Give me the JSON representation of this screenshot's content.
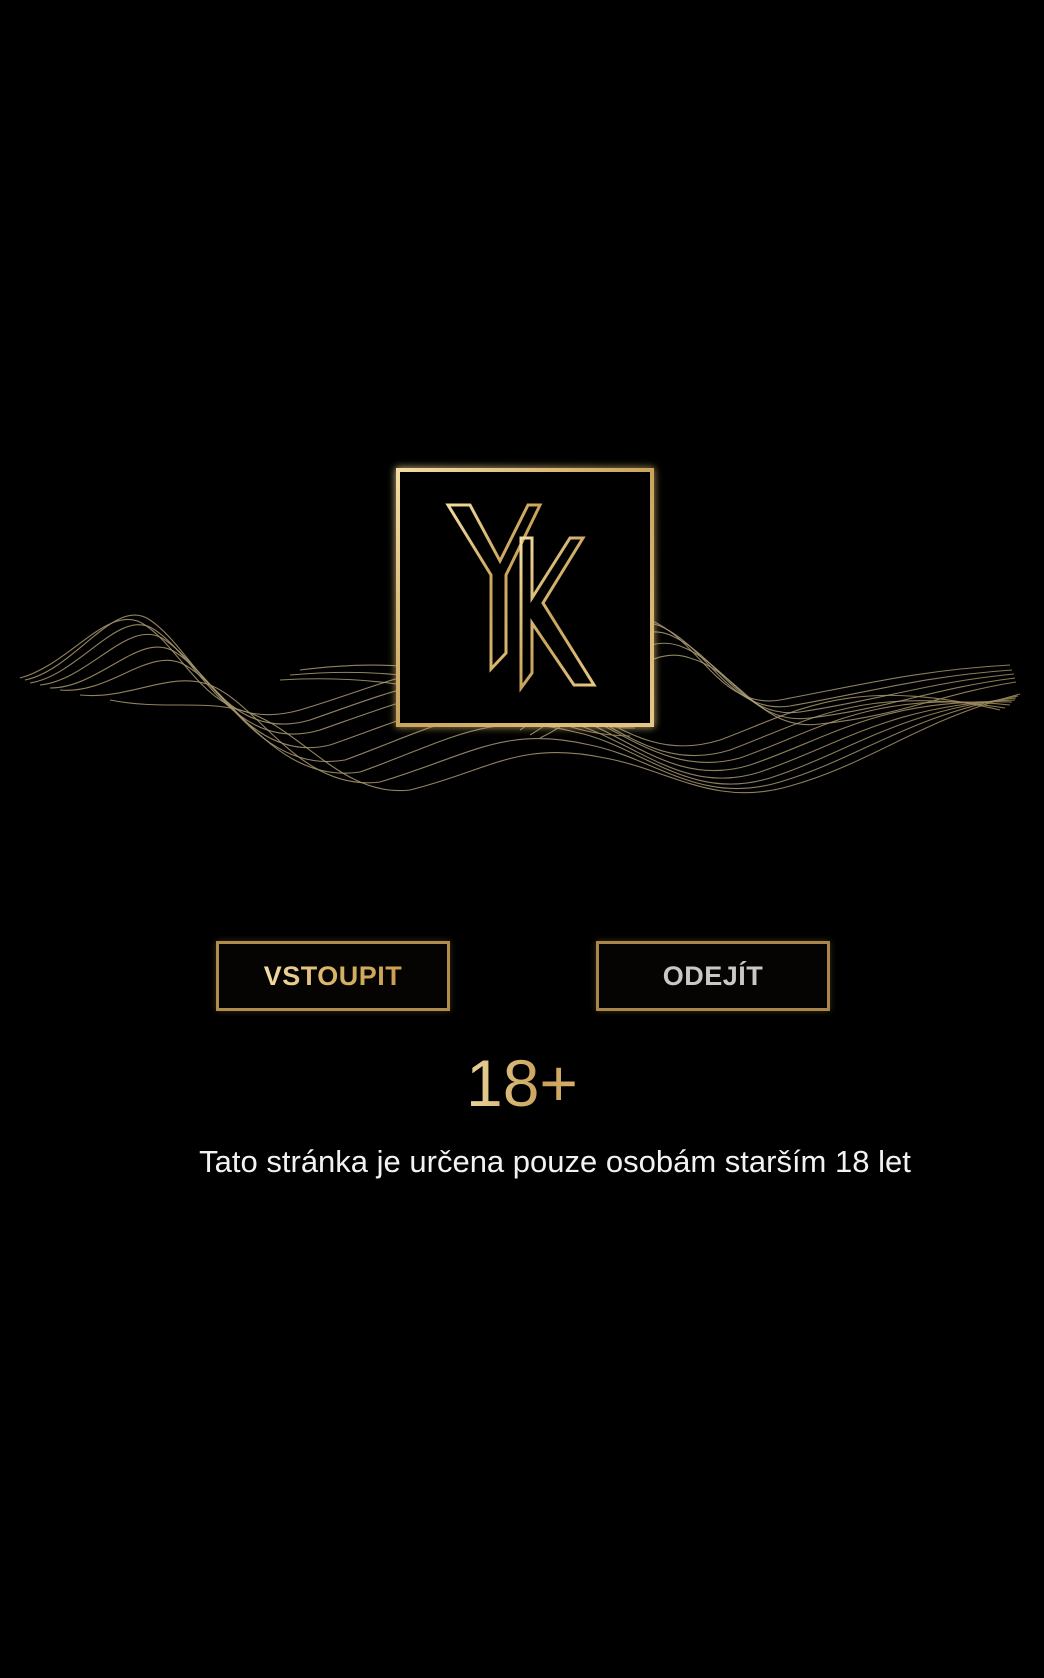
{
  "logo": {
    "monogram": "YK",
    "accent_color": "#c9a45c"
  },
  "buttons": {
    "enter_label": "VSTOUPIT",
    "leave_label": "ODEJÍT"
  },
  "age_badge": "18+",
  "notice_text": "Tato stránka je určena pouze osobám starším 18 let",
  "colors": {
    "background": "#000000",
    "gold": "#c9a45c",
    "light_gold": "#f3dfa6",
    "text": "#f2f2f2"
  }
}
